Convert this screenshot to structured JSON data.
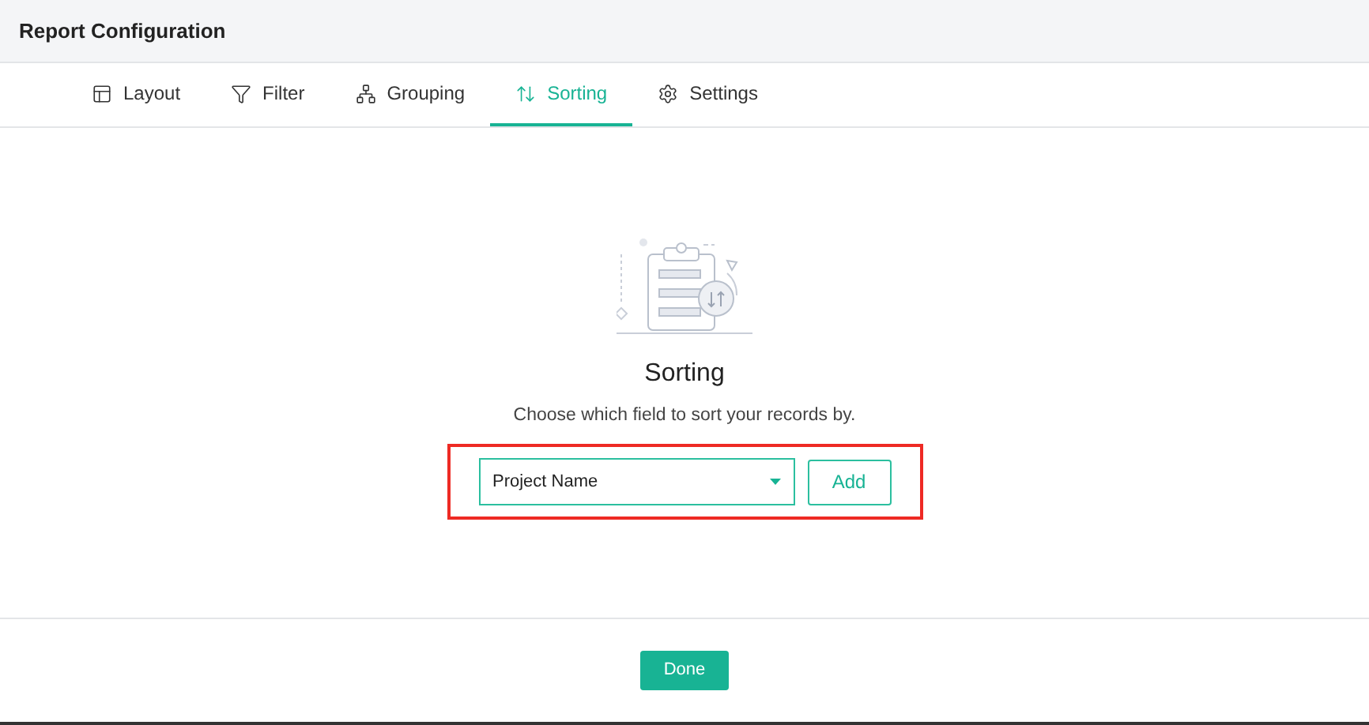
{
  "window": {
    "title": "Report Configuration"
  },
  "tabs": [
    {
      "label": "Layout",
      "kind": "layout",
      "selected": false
    },
    {
      "label": "Filter",
      "kind": "filter",
      "selected": false
    },
    {
      "label": "Grouping",
      "kind": "grouping",
      "selected": false
    },
    {
      "label": "Sorting",
      "kind": "sorting",
      "selected": true
    },
    {
      "label": "Settings",
      "kind": "settings",
      "selected": false
    }
  ],
  "empty_state": {
    "title": "Sorting",
    "description": "Choose which field to sort your records by."
  },
  "sort_field": {
    "value": "Project Name"
  },
  "add_button": "Add",
  "highlight": true,
  "done_button": "Done"
}
